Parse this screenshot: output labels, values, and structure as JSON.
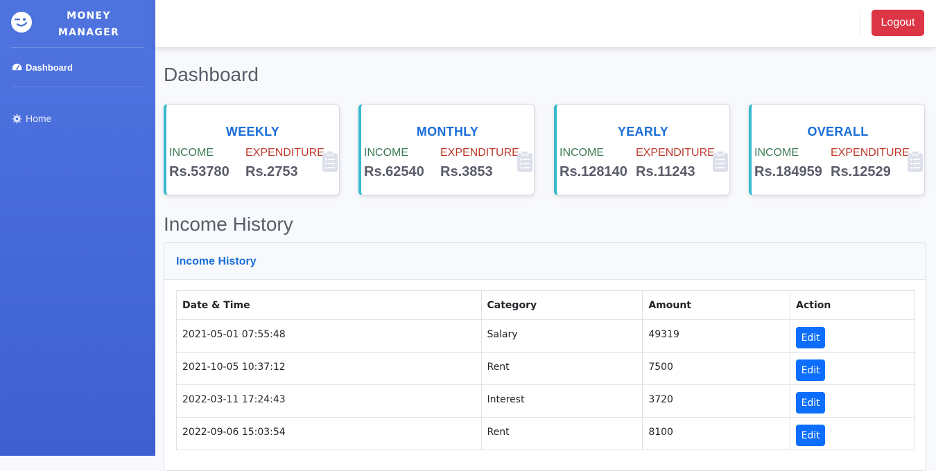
{
  "brand": {
    "line1": "MONEY",
    "line2": "MANAGER",
    "icon": "wink-face-icon"
  },
  "sidebar": {
    "items": [
      {
        "label": "Dashboard",
        "icon": "tachometer-icon",
        "active": true
      },
      {
        "label": "Home",
        "icon": "gear-icon",
        "active": false
      }
    ]
  },
  "topbar": {
    "logout_label": "Logout"
  },
  "page_title": "Dashboard",
  "cards": [
    {
      "title": "WEEKLY",
      "income_label": "INCOME",
      "expenditure_label": "EXPENDITURE",
      "income": "Rs.53780",
      "expenditure": "Rs.2753"
    },
    {
      "title": "MONTHLY",
      "income_label": "INCOME",
      "expenditure_label": "EXPENDITURE",
      "income": "Rs.62540",
      "expenditure": "Rs.3853"
    },
    {
      "title": "YEARLY",
      "income_label": "INCOME",
      "expenditure_label": "EXPENDITURE",
      "income": "Rs.128140",
      "expenditure": "Rs.11243"
    },
    {
      "title": "OVERALL",
      "income_label": "INCOME",
      "expenditure_label": "EXPENDITURE",
      "income": "Rs.184959",
      "expenditure": "Rs.12529"
    }
  ],
  "income_history": {
    "section_title": "Income History",
    "panel_title": "Income History",
    "columns": [
      "Date & Time",
      "Category",
      "Amount",
      "Action"
    ],
    "rows": [
      {
        "datetime": "2021-05-01 07:55:48",
        "category": "Salary",
        "amount": "49319",
        "action": "Edit"
      },
      {
        "datetime": "2021-10-05 10:37:12",
        "category": "Rent",
        "amount": "7500",
        "action": "Edit"
      },
      {
        "datetime": "2022-03-11 17:24:43",
        "category": "Interest",
        "amount": "3720",
        "action": "Edit"
      },
      {
        "datetime": "2022-09-06 15:03:54",
        "category": "Rent",
        "amount": "8100",
        "action": "Edit"
      }
    ]
  },
  "colors": {
    "sidebar": "#4e73df",
    "logout": "#dc3545",
    "accent": "#1b6fd9",
    "card_border": "#36b9cc",
    "edit": "#0d6efd"
  }
}
